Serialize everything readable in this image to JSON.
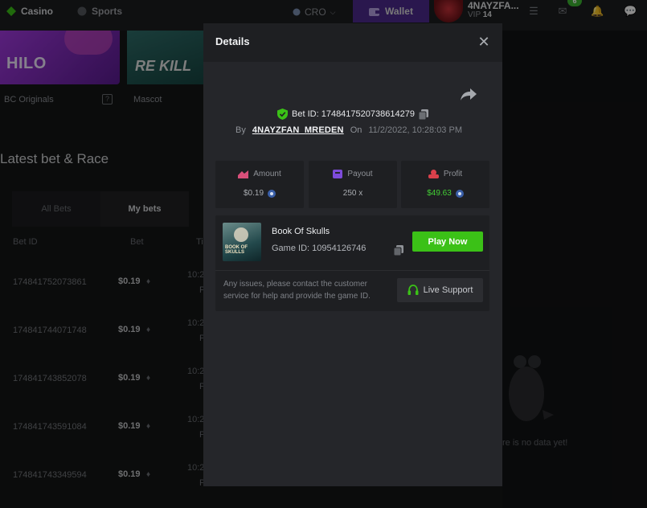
{
  "topbar": {
    "casino": "Casino",
    "sports": "Sports",
    "currency": "CRO",
    "wallet": "Wallet",
    "username": "4NAYZFA...",
    "vip_label": "VIP",
    "vip_level": "14",
    "notification_count": "6"
  },
  "games": [
    {
      "thumb_text": "HILO",
      "label": "BC Originals"
    },
    {
      "thumb_text": "RE KILL",
      "label": "Mascot"
    }
  ],
  "section": {
    "title": "Latest bet & Race",
    "tabs": [
      "All Bets",
      "My bets"
    ],
    "columns": [
      "Bet ID",
      "Bet",
      "Ti"
    ]
  },
  "bets": [
    {
      "id": "174841752073861",
      "amount": "$0.19",
      "t1": "10:2",
      "t2": "P"
    },
    {
      "id": "174841744071748",
      "amount": "$0.19",
      "t1": "10:2",
      "t2": "P"
    },
    {
      "id": "174841743852078",
      "amount": "$0.19",
      "t1": "10:2",
      "t2": "P"
    },
    {
      "id": "174841743591084",
      "amount": "$0.19",
      "t1": "10:2",
      "t2": "P"
    },
    {
      "id": "174841743349594",
      "amount": "$0.19",
      "t1": "10:2",
      "t2": "P"
    }
  ],
  "right_panel": {
    "empty_text": "re is no data yet!"
  },
  "modal": {
    "title": "Details",
    "bet_id": "Bet ID: 1748417520738614279",
    "by_label": "By",
    "user": "4NAYZFAN_MREDEN",
    "on_label": "On",
    "date": "11/2/2022, 10:28:03 PM",
    "stats": [
      {
        "label": "Amount",
        "value": "$0.19",
        "icon": "amount-icon",
        "color": "#d84f7a"
      },
      {
        "label": "Payout",
        "value": "250 x",
        "icon": "payout-icon",
        "color": "#7d4bd9"
      },
      {
        "label": "Profit",
        "value": "$49.63",
        "icon": "profit-icon",
        "color": "#d8404b"
      }
    ],
    "game": {
      "thumb_text": "BOOK OF SKULLS",
      "name": "Book Of Skulls",
      "game_id": "Game ID: 10954126746",
      "play_label": "Play Now"
    },
    "issue_text": "Any issues, please contact the customer service for help and provide the game ID.",
    "support_label": "Live Support"
  },
  "colors": {
    "accent_green": "#3bc117",
    "profit_green": "#43cf35",
    "wallet_purple": "#4e2a8e"
  }
}
